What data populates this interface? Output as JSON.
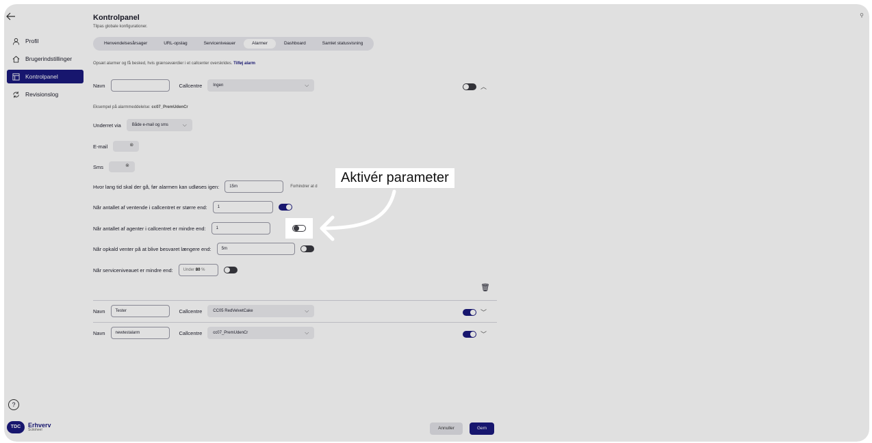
{
  "header": {
    "title": "Kontrolpanel",
    "subtitle": "Tilpas globale konfigurationer."
  },
  "sidebar": {
    "items": [
      {
        "label": "Profil",
        "icon": "person-icon"
      },
      {
        "label": "Brugerindstillinger",
        "icon": "home-icon"
      },
      {
        "label": "Kontrolpanel",
        "icon": "panel-icon",
        "active": true
      },
      {
        "label": "Revisionslog",
        "icon": "sync-icon"
      }
    ],
    "help": "?",
    "logo": {
      "badge": "TDC",
      "name": "Erhverv",
      "sub": "Scitoheel"
    }
  },
  "tabs": [
    "Henvendelsesårsager",
    "URL-opslag",
    "Serviceniveauer",
    "Alarmer",
    "Dashboard",
    "Samlet statusvisning"
  ],
  "active_tab": "Alarmer",
  "intro": {
    "text": "Opsæt alarmer og få besked, hvis grænseværdier i et callcenter overskrides.",
    "link": "Tilføj alarm"
  },
  "alarm_form": {
    "name_label": "Navn",
    "name_value": "",
    "callcentre_label": "Callcentre",
    "callcentre_value": "Ingen",
    "example_label": "Eksempel på alarmmeddelelse:",
    "example_value": "cc07_PremUdenCr",
    "notify_label": "Underret via",
    "notify_value": "Både e-mail og sms",
    "email_label": "E-mail",
    "sms_label": "Sms",
    "repeat_label": "Hvor lang tid skal der gå, før alarmen kan udløses igen:",
    "repeat_value": "15m",
    "repeat_hint": "Forhindrer at d",
    "waiting_label": "Når antallet af ventende i callcentret er større end:",
    "waiting_value": "1",
    "agents_label": "Når antallet af agenter i callcentret er mindre end:",
    "agents_value": "1",
    "wait_time_label": "Når opkald venter på at blive besvaret længere end:",
    "wait_time_value": "5m",
    "service_label": "Når serviceniveauet er mindre end:",
    "service_prefix": "Under",
    "service_value": "80",
    "service_unit": "%"
  },
  "alarms": [
    {
      "name_label": "Navn",
      "name": "Tester",
      "callcentre_label": "Callcentre",
      "callcentre": "CC05 RedVelvetCake"
    },
    {
      "name_label": "Navn",
      "name": "newtestalarm",
      "callcentre_label": "Callcentre",
      "callcentre": "cc07_PremUdenCr"
    }
  ],
  "callout": "Aktivér parameter",
  "buttons": {
    "cancel": "Annuller",
    "save": "Gem"
  },
  "colors": {
    "accent": "#1b1a7e"
  }
}
